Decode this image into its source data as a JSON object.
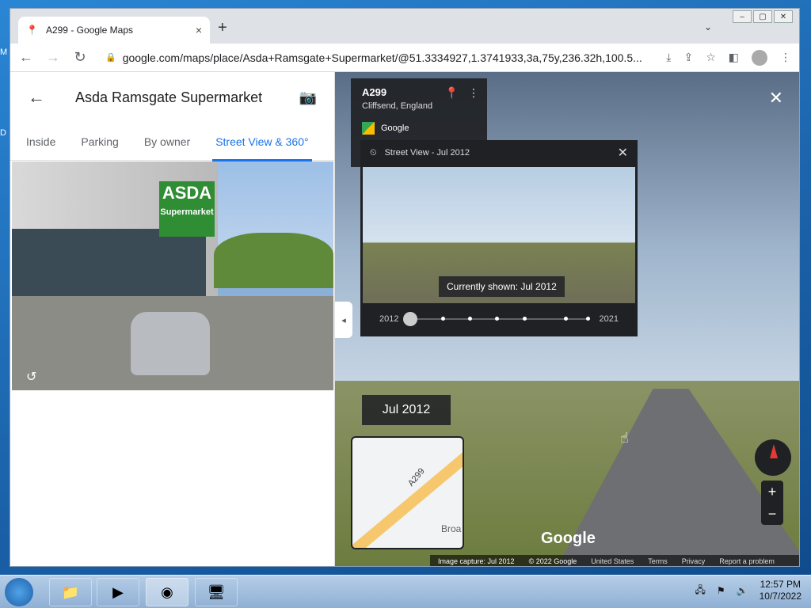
{
  "browser": {
    "tab_title": "A299 - Google Maps",
    "tab_close": "×",
    "new_tab": "+",
    "url": "google.com/maps/place/Asda+Ramsgate+Supermarket/@51.3334927,1.3741933,3a,75y,236.32h,100.5...",
    "win_min": "‒",
    "win_max": "▢",
    "win_close": "✕",
    "tab_menu": "⌄",
    "back": "←",
    "forward": "→",
    "reload": "↻",
    "lock": "🔒",
    "install": "⤓",
    "share": "⇪",
    "bookmark": "☆",
    "sidepanel": "◧",
    "menu": "⋮"
  },
  "desktop": {
    "label1": "M",
    "label2": "D"
  },
  "place": {
    "title": "Asda Ramsgate Supermarket",
    "back_icon": "←",
    "camera_icon": "📷",
    "tabs": [
      "Inside",
      "Parking",
      "By owner",
      "Street View & 360°"
    ],
    "active_tab_index": 3,
    "photo_sign_line1": "ASDA",
    "photo_sign_line2": "Supermarket",
    "rotate_icon": "↺"
  },
  "streetview": {
    "road": "A299",
    "place": "Cliffsend, England",
    "provider": "Google",
    "pin_icon": "📍",
    "more_icon": "⋮",
    "close_icon": "✕",
    "collapse_icon": "◂",
    "timemachine": {
      "history_icon": "⏲",
      "label": "Street View - Jul 2012",
      "close_icon": "✕",
      "currently_shown": "Currently shown: Jul 2012",
      "year_start": "2012",
      "year_end": "2021"
    },
    "date_badge": "Jul 2012",
    "minimap": {
      "road_label": "A299",
      "place_label": "Broa"
    },
    "logo": "Google",
    "footer": {
      "capture": "Image capture: Jul 2012",
      "copyright": "© 2022 Google",
      "region": "United States",
      "terms": "Terms",
      "privacy": "Privacy",
      "report": "Report a problem"
    },
    "zoom_in": "+",
    "zoom_out": "−",
    "pointer_icon": "☝"
  },
  "taskbar": {
    "apps": [
      "📁",
      "▶",
      "◉",
      "🖥"
    ],
    "tray_icons": [
      "🖧",
      "⚑",
      "🔊"
    ],
    "time": "12:57 PM",
    "date": "10/7/2022"
  }
}
